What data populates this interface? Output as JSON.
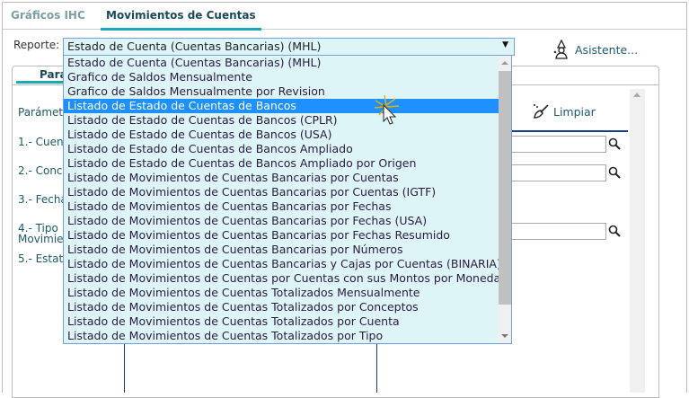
{
  "tabs": [
    {
      "label": "Gráficos IHC",
      "active": false
    },
    {
      "label": "Movimientos de Cuentas",
      "active": true
    }
  ],
  "reporte": {
    "label": "Reporte:",
    "selected": "Estado de Cuenta (Cuentas Bancarias) (MHL)"
  },
  "asistente": {
    "label": "Asistente...",
    "icon": "wizard-icon"
  },
  "panel": {
    "tab": "Pará",
    "parametros_label": "Parámetr",
    "limpiar": "Limpiar",
    "fields": [
      "1.- Cuen",
      "2.- Conc",
      "3.- Fecha",
      "4.- Tipo",
      "Movimien",
      "5.- Estat"
    ]
  },
  "dropdown": {
    "highlighted_index": 3,
    "options": [
      "Estado de Cuenta (Cuentas Bancarias) (MHL)",
      "Grafico de Saldos Mensualmente",
      "Grafico de Saldos Mensualmente por Revision",
      "Listado de Estado de Cuentas de Bancos",
      "Listado de Estado de Cuentas de Bancos (CPLR)",
      "Listado de Estado de Cuentas de Bancos (USA)",
      "Listado de Estado de Cuentas de Bancos Ampliado",
      "Listado de Estado de Cuentas de Bancos Ampliado por Origen",
      "Listado de Movimientos de Cuentas Bancarias por Cuentas",
      "Listado de Movimientos de Cuentas Bancarias por Cuentas (IGTF)",
      "Listado de Movimientos de Cuentas Bancarias por Fechas",
      "Listado de Movimientos de Cuentas Bancarias por Fechas (USA)",
      "Listado de Movimientos de Cuentas Bancarias por Fechas Resumido",
      "Listado de Movimientos de Cuentas Bancarias por Números",
      "Listado de Movimientos de Cuentas Bancarias y Cajas por Cuentas (BINARIA)",
      "Listado de Movimientos de Cuentas por Cuentas con sus Montos por Moneda",
      "Listado de Movimientos de Cuentas Totalizados Mensualmente",
      "Listado de Movimientos de Cuentas Totalizados por Conceptos",
      "Listado de Movimientos de Cuentas Totalizados por Cuenta",
      "Listado de Movimientos de Cuentas Totalizados por Tipo"
    ]
  },
  "colors": {
    "accent": "#1aa7b8",
    "highlight": "#1e90ff",
    "list_bg": "#def5f8"
  }
}
